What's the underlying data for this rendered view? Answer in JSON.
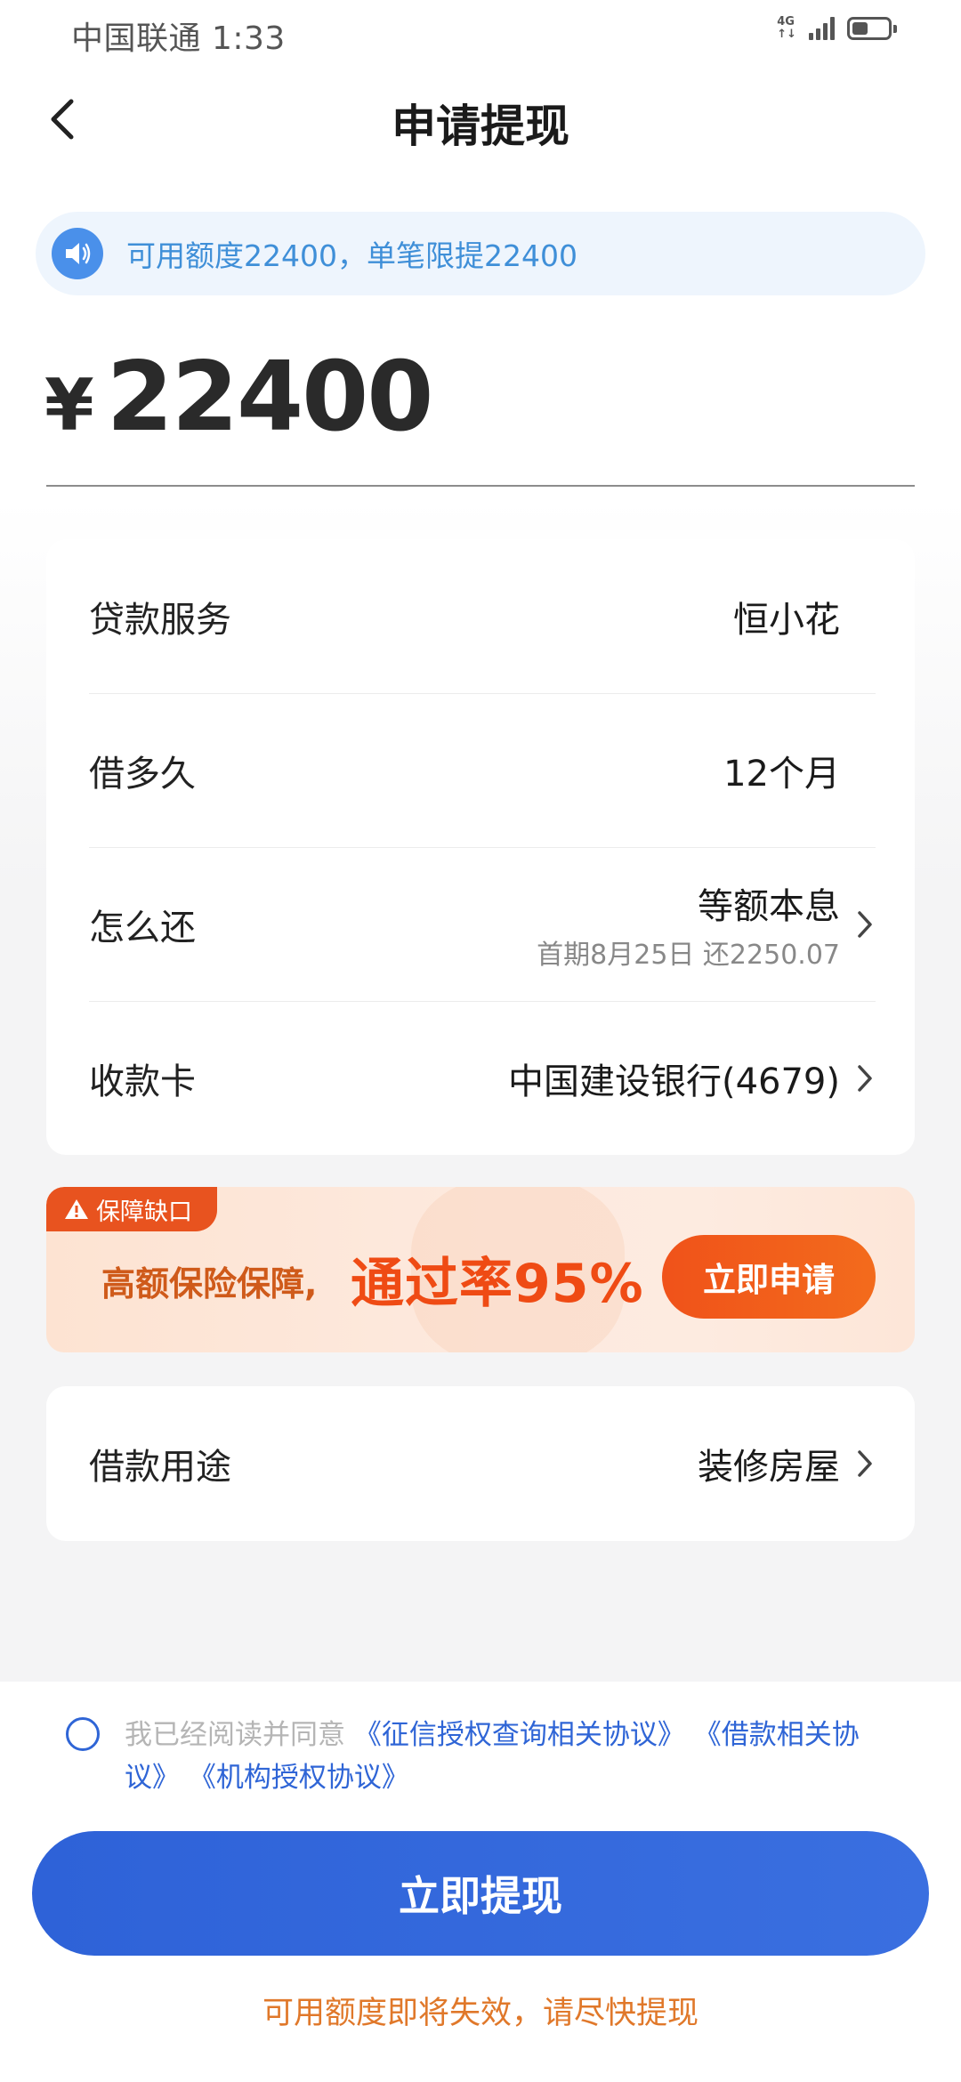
{
  "status_bar": {
    "carrier_time": "中国联通 1:33",
    "network": "4G",
    "battery_level": 0.45
  },
  "header": {
    "title": "申请提现"
  },
  "notice": {
    "text": "可用额度22400，单笔限提22400"
  },
  "amount": {
    "currency": "¥",
    "value": "22400"
  },
  "details": {
    "loan_service": {
      "label": "贷款服务",
      "value": "恒小花"
    },
    "duration": {
      "label": "借多久",
      "value": "12个月"
    },
    "repayment": {
      "label": "怎么还",
      "value": "等额本息",
      "sub": "首期8月25日 还2250.07"
    },
    "card": {
      "label": "收款卡",
      "value": "中国建设银行(4679)"
    }
  },
  "promo": {
    "tag": "保障缺口",
    "text1": "高额保险保障,",
    "text2": "通过率95%",
    "button": "立即申请"
  },
  "purpose": {
    "label": "借款用途",
    "value": "装修房屋"
  },
  "agreement": {
    "prefix": "我已经阅读并同意",
    "link1": "《征信授权查询相关协议》",
    "link2": "《借款相关协议》",
    "link3": "《机构授权协议》",
    "checked": false
  },
  "actions": {
    "submit": "立即提现",
    "note": "可用额度即将失效，请尽快提现"
  },
  "colors": {
    "primary": "#2f65d6",
    "accent_orange": "#ef4b14",
    "note_orange": "#e0782a",
    "notice_blue": "#3f8fd8"
  }
}
